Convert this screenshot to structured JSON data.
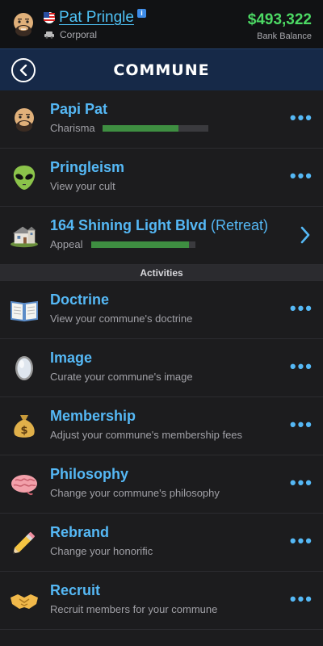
{
  "header": {
    "player_name": "Pat Pringle",
    "info_badge": "i",
    "rank": "Corporal",
    "bank_value": "$493,322",
    "bank_label": "Bank Balance"
  },
  "titlebar": {
    "title": "COMMUNE",
    "back_icon": "chevron-left-icon"
  },
  "rows_top": [
    {
      "icon": "bald-man-face-icon",
      "title": "Papi Pat",
      "sub": "Charisma",
      "bar_fraction": 0.72,
      "action": "more"
    },
    {
      "icon": "alien-icon",
      "title": "Pringleism",
      "sub": "View your cult",
      "action": "more"
    },
    {
      "icon": "house-icon",
      "title": "164 Shining Light Blvd",
      "title_suffix": " (Retreat)",
      "sub": "Appeal",
      "bar_fraction": 0.94,
      "action": "chevron"
    }
  ],
  "section": {
    "label": "Activities"
  },
  "activities": [
    {
      "icon": "open-book-icon",
      "title": "Doctrine",
      "sub": "View your commune's doctrine"
    },
    {
      "icon": "mirror-icon",
      "title": "Image",
      "sub": "Curate your commune's image"
    },
    {
      "icon": "money-bag-icon",
      "title": "Membership",
      "sub": "Adjust your commune's membership fees"
    },
    {
      "icon": "brain-icon",
      "title": "Philosophy",
      "sub": "Change your commune's philosophy"
    },
    {
      "icon": "pencil-icon",
      "title": "Rebrand",
      "sub": "Change your honorific"
    },
    {
      "icon": "handshake-icon",
      "title": "Recruit",
      "sub": "Recruit members for your commune"
    }
  ],
  "more_glyph": "•••",
  "colors": {
    "accent": "#55b8f5",
    "money": "#4cd964",
    "bar_fill": "#3e8e41",
    "title_bar": "#162948"
  }
}
